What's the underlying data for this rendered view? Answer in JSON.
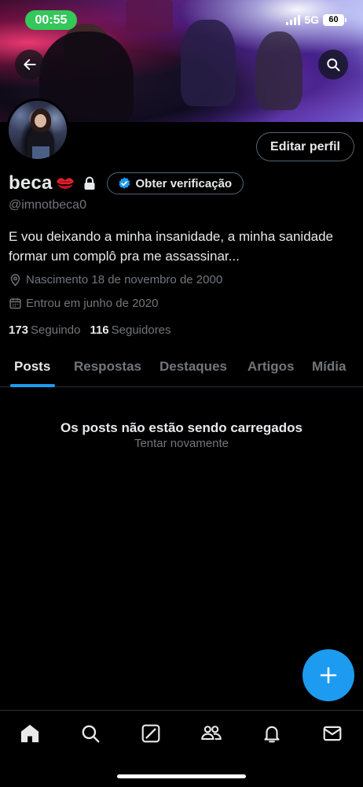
{
  "status_bar": {
    "time": "00:55",
    "network": "5G",
    "battery": "60"
  },
  "profile": {
    "name": "beca",
    "handle": "@imnotbeca0",
    "edit_label": "Editar perfil",
    "verify_label": "Obter verificação",
    "bio_lines": [
      "E vou deixando a minha insanidade, a minha sanidade",
      "formar um complô pra me assassinar..."
    ],
    "birth": "Nascimento 18 de novembro de 2000",
    "joined": "Entrou em junho de 2020",
    "following_count": "173",
    "following_label": "Seguindo",
    "followers_count": "116",
    "followers_label": "Seguidores"
  },
  "tabs": [
    {
      "label": "Posts",
      "active": true
    },
    {
      "label": "Respostas",
      "active": false
    },
    {
      "label": "Destaques",
      "active": false
    },
    {
      "label": "Artigos",
      "active": false
    },
    {
      "label": "Mídia",
      "active": false
    }
  ],
  "feed": {
    "empty_title": "Os posts não estão sendo carregados",
    "retry_label": "Tentar novamente"
  },
  "bottom_nav": [
    "home-icon",
    "search-icon",
    "grok-icon",
    "communities-icon",
    "notifications-icon",
    "messages-icon"
  ],
  "colors": {
    "accent": "#1d9bf0",
    "status_pill": "#34c759",
    "secondary_text": "#71767b"
  }
}
